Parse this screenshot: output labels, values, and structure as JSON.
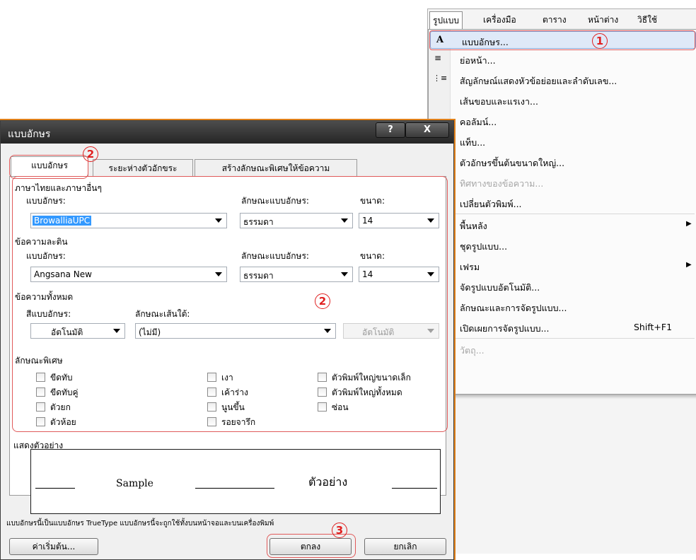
{
  "menubar": {
    "items": [
      "รูปแบบ",
      "เครื่องมือ",
      "ตาราง",
      "หน้าต่าง",
      "วิธีใช้"
    ]
  },
  "dropdown": {
    "items": [
      {
        "icon": "A",
        "label": "แบบอักษร...",
        "shortcut": "",
        "submenu": false,
        "disabled": false
      },
      {
        "icon": "≡",
        "label": "ย่อหน้า...",
        "shortcut": "",
        "submenu": false,
        "disabled": false
      },
      {
        "icon": "⋮≡",
        "label": "สัญลักษณ์แสดงหัวข้อย่อยและลำดับเลข...",
        "shortcut": "",
        "submenu": false,
        "disabled": false
      },
      {
        "icon": "",
        "label": "เส้นขอบและแรเงา...",
        "shortcut": "",
        "submenu": false,
        "disabled": false
      },
      {
        "icon": "",
        "label": "คอลัมน์...",
        "shortcut": "",
        "submenu": false,
        "disabled": false
      },
      {
        "icon": "",
        "label": "แท็บ...",
        "shortcut": "",
        "submenu": false,
        "disabled": false
      },
      {
        "icon": "",
        "label": "ตัวอักษรขึ้นต้นขนาดใหญ่...",
        "shortcut": "",
        "submenu": false,
        "disabled": false
      },
      {
        "icon": "",
        "label": "ทิศทางของข้อความ...",
        "shortcut": "",
        "submenu": false,
        "disabled": true
      },
      {
        "icon": "",
        "label": "เปลี่ยนตัวพิมพ์...",
        "shortcut": "",
        "submenu": false,
        "disabled": false
      },
      {
        "icon": "",
        "label": "พื้นหลัง",
        "shortcut": "",
        "submenu": true,
        "disabled": false
      },
      {
        "icon": "",
        "label": "ชุดรูปแบบ...",
        "shortcut": "",
        "submenu": false,
        "disabled": false
      },
      {
        "icon": "",
        "label": "เฟรม",
        "shortcut": "",
        "submenu": true,
        "disabled": false
      },
      {
        "icon": "",
        "label": "จัดรูปแบบอัตโนมัติ...",
        "shortcut": "",
        "submenu": false,
        "disabled": false
      },
      {
        "icon": "",
        "label": "ลักษณะและการจัดรูปแบบ...",
        "shortcut": "",
        "submenu": false,
        "disabled": false
      },
      {
        "icon": "",
        "label": "เปิดเผยการจัดรูปแบบ...",
        "shortcut": "Shift+F1",
        "submenu": false,
        "disabled": false
      },
      {
        "icon": "",
        "label": "วัตถุ...",
        "shortcut": "",
        "submenu": false,
        "disabled": true
      }
    ]
  },
  "dialog": {
    "title": "แบบอักษร",
    "help_label": "?",
    "close_label": "X",
    "tabs": [
      "แบบอักษร",
      "ระยะห่างตัวอักขระ",
      "สร้างลักษณะพิเศษให้ข้อความ"
    ],
    "thai_group": {
      "heading": "ภาษาไทยและภาษาอื่นๆ",
      "font_label": "แบบอักษร:",
      "font_value": "BrowalliaUPC",
      "style_label": "ลักษณะแบบอักษร:",
      "style_value": "ธรรมดา",
      "size_label": "ขนาด:",
      "size_value": "14"
    },
    "latin_group": {
      "heading": "ข้อความละติน",
      "font_label": "แบบอักษร:",
      "font_value": "Angsana New",
      "style_label": "ลักษณะแบบอักษร:",
      "style_value": "ธรรมดา",
      "size_label": "ขนาด:",
      "size_value": "14"
    },
    "all_text": {
      "heading": "ข้อความทั้งหมด",
      "color_label": "สีแบบอักษร:",
      "color_value": "อัตโนมัติ",
      "underline_label": "ลักษณะเส้นใต้:",
      "underline_value": "(ไม่มี)",
      "underline_color_value": "อัตโนมัติ"
    },
    "effects": {
      "heading": "ลักษณะพิเศษ",
      "col1": [
        "ขีดทับ",
        "ขีดทับคู่",
        "ตัวยก",
        "ตัวห้อย"
      ],
      "col2": [
        "เงา",
        "เค้าร่าง",
        "นูนขึ้น",
        "รอยจารึก"
      ],
      "col3": [
        "ตัวพิมพ์ใหญ่ขนาดเล็ก",
        "ตัวพิมพ์ใหญ่ทั้งหมด",
        "ซ่อน"
      ]
    },
    "preview": {
      "label": "แสดงตัวอย่าง",
      "sample_en": "Sample",
      "sample_th": "ตัวอย่าง"
    },
    "note": "แบบอักษรนี้เป็นแบบอักษร TrueType  แบบอักษรนี้จะถูกใช้ทั้งบนหน้าจอและบนเครื่องพิมพ์",
    "buttons": {
      "default": "ค่าเริ่มต้น...",
      "ok": "ตกลง",
      "cancel": "ยกเลิก"
    }
  },
  "annotations": {
    "one": "1",
    "two": "2",
    "three": "3",
    "color": "#e02020"
  }
}
